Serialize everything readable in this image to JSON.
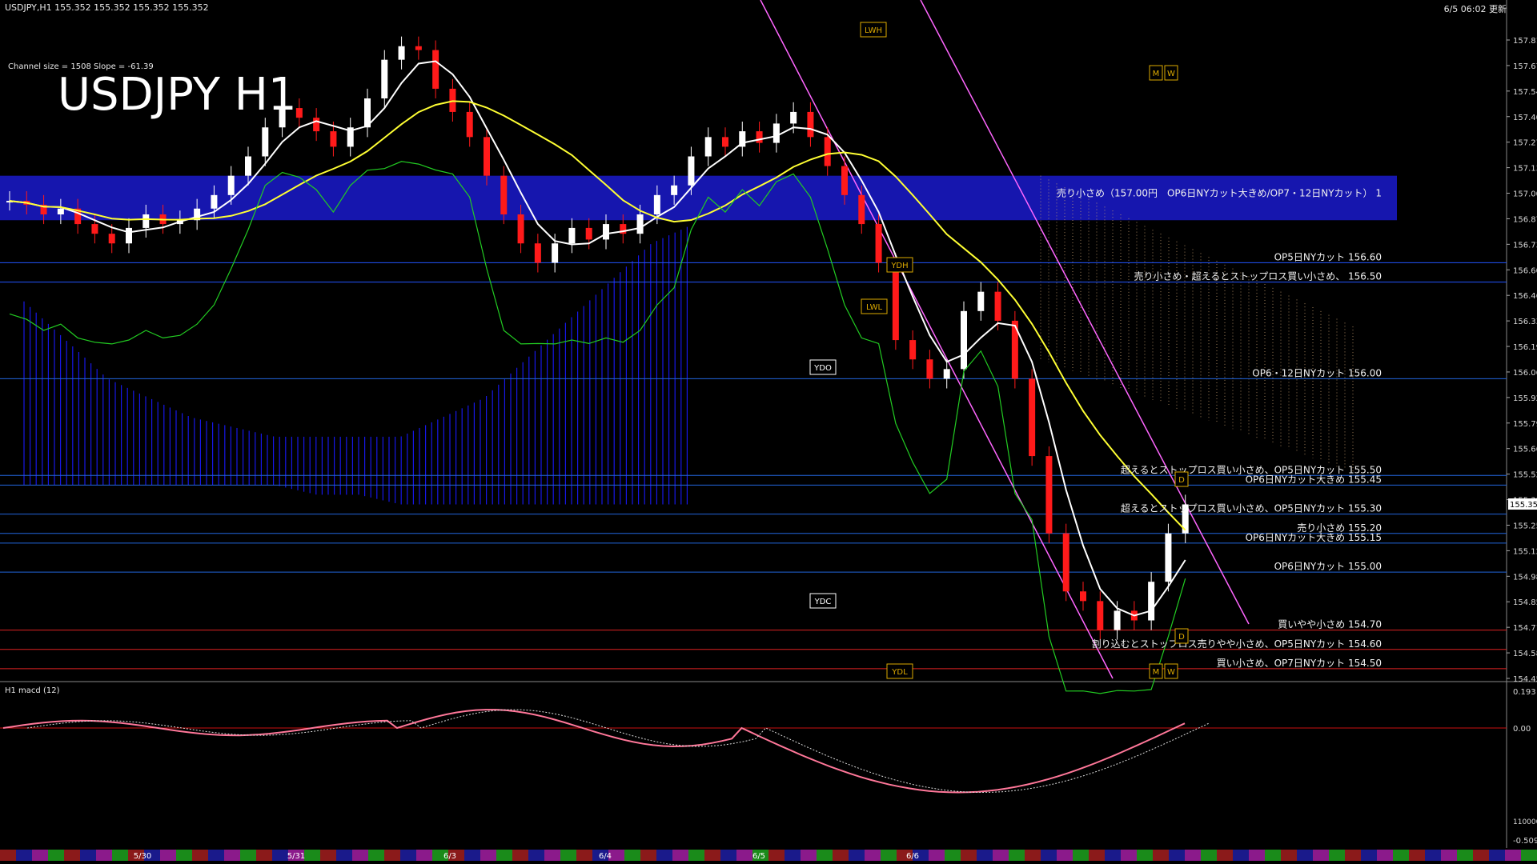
{
  "header": {
    "symbol_line": "USDJPY,H1  155.352 155.352 155.352 155.352",
    "datetime": "6/5 06:02 更新",
    "channel_info": "Channel size = 1508 Slope = -61.39",
    "big_title": "USDJPY H1",
    "macd_label": "H1  macd (12)"
  },
  "colors": {
    "bull": "#ffffff",
    "bear": "#ff1a1a",
    "cloud": "#1a1aff",
    "band": "#1a1acc",
    "sma_fast": "#ffffff",
    "sma_slow": "#ffff33",
    "chikou": "#22cc22",
    "channel": "#ff66ff",
    "macd_up": "#33ff33",
    "macd_down": "#ff7799"
  },
  "chart_data": {
    "type": "line",
    "y_axis_ticks": [
      "157.810",
      "157.675",
      "157.540",
      "157.405",
      "157.270",
      "157.135",
      "157.000",
      "156.870",
      "156.735",
      "156.600",
      "156.465",
      "156.330",
      "156.195",
      "156.060",
      "155.925",
      "155.790",
      "155.660",
      "155.525",
      "155.390",
      "155.255",
      "155.120",
      "154.985",
      "154.850",
      "154.715",
      "154.580",
      "154.450"
    ],
    "current_price": "155.352",
    "ylim": [
      154.45,
      157.81
    ],
    "x_date_labels": [
      "5/30",
      "5/31",
      "6/3",
      "6/4",
      "6/5",
      "6/6"
    ],
    "macd_axis": [
      "0.193",
      "0.00",
      "-0.509"
    ],
    "macd_extra": "110000",
    "box_labels": [
      "LWH",
      "YDH",
      "LWL",
      "YDO",
      "YDC",
      "YDL",
      "M",
      "W",
      "M",
      "W",
      "D",
      "D"
    ],
    "level_notes": [
      {
        "text": "売り小さめ（157.00円　OP6日NYカット大きめ/OP7・12日NYカット）  1",
        "price": 156.93
      },
      {
        "text": "OP5日NYカット 156.60",
        "price": 156.6
      },
      {
        "text": "売り小さめ・超えるとストップロス買い小さめ、 156.50",
        "price": 156.5
      },
      {
        "text": "OP6・12日NYカット 156.00",
        "price": 156.0
      },
      {
        "text": "超えるとストップロス買い小さめ、OP5日NYカット 155.50",
        "price": 155.5
      },
      {
        "text": "OP6日NYカット大きめ 155.45",
        "price": 155.45
      },
      {
        "text": "超えるとストップロス買い小さめ、OP5日NYカット 155.30",
        "price": 155.3
      },
      {
        "text": "売り小さめ 155.20",
        "price": 155.2
      },
      {
        "text": "OP6日NYカット大きめ 155.15",
        "price": 155.15
      },
      {
        "text": "OP6日NYカット 155.00",
        "price": 155.0
      },
      {
        "text": "買いやや小さめ 154.70",
        "price": 154.7
      },
      {
        "text": "割り込むとストップロス売りやや小さめ、OP5日NYカット 154.60",
        "price": 154.6
      },
      {
        "text": "買い小さめ、OP7日NYカット 154.50",
        "price": 154.5
      }
    ],
    "close_path": [
      156.92,
      156.9,
      156.85,
      156.88,
      156.8,
      156.75,
      156.7,
      156.78,
      156.85,
      156.8,
      156.82,
      156.88,
      156.95,
      157.05,
      157.15,
      157.3,
      157.4,
      157.35,
      157.28,
      157.2,
      157.3,
      157.45,
      157.65,
      157.72,
      157.7,
      157.5,
      157.38,
      157.25,
      157.05,
      156.85,
      156.7,
      156.6,
      156.7,
      156.78,
      156.72,
      156.8,
      156.75,
      156.85,
      156.95,
      157.0,
      157.15,
      157.25,
      157.2,
      157.28,
      157.22,
      157.32,
      157.38,
      157.25,
      157.1,
      156.95,
      156.8,
      156.6,
      156.2,
      156.1,
      156.0,
      156.05,
      156.35,
      156.45,
      156.3,
      156.0,
      155.6,
      155.2,
      154.9,
      154.85,
      154.7,
      154.8,
      154.75,
      154.95,
      155.2,
      155.35
    ]
  }
}
